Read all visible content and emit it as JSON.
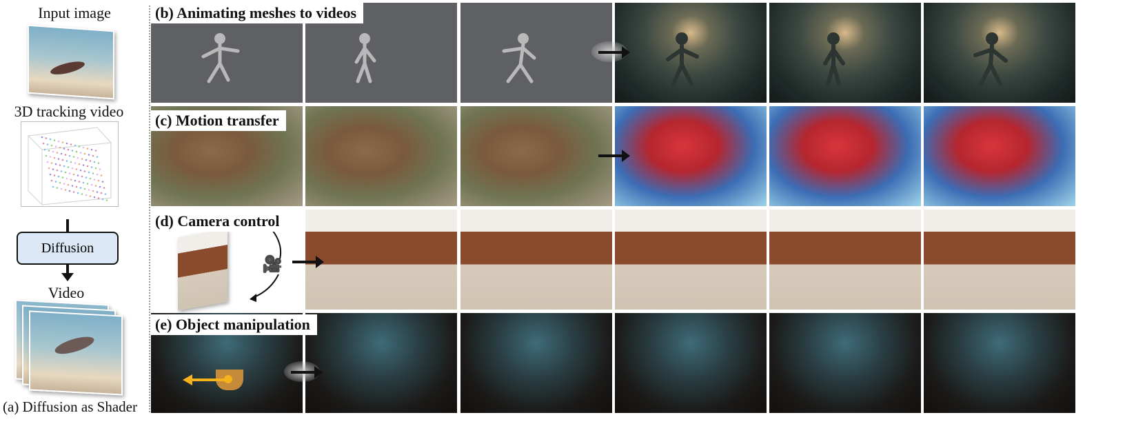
{
  "left_panel": {
    "input_label": "Input image",
    "tracking_label": "3D tracking video",
    "diffusion_label": "Diffusion",
    "video_label": "Video",
    "caption": "(a) Diffusion as Shader"
  },
  "rows": [
    {
      "label": "(b) Animating meshes to videos"
    },
    {
      "label": "(c) Motion transfer"
    },
    {
      "label": "(d) Camera control"
    },
    {
      "label": "(e) Object manipulation"
    }
  ],
  "icons": {
    "camera": "camera-icon",
    "arrow": "arrow-right-icon"
  },
  "colors": {
    "diffusion_box": "#dce8f5",
    "mesh_gray": "#5f6064",
    "manipulation_arrow": "#f5b21a"
  }
}
